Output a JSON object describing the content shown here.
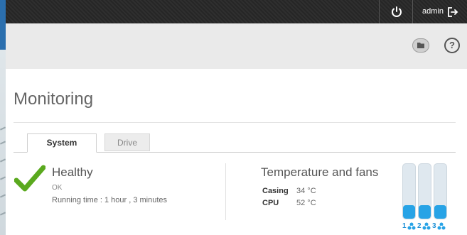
{
  "topbar": {
    "user": "admin"
  },
  "page": {
    "title": "Monitoring"
  },
  "tabs": [
    {
      "label": "System",
      "active": true
    },
    {
      "label": "Drive",
      "active": false
    }
  ],
  "health": {
    "title": "Healthy",
    "status": "OK",
    "running_time": "Running time : 1 hour , 3 minutes"
  },
  "temperature": {
    "title": "Temperature and fans",
    "rows": [
      {
        "label": "Casing",
        "value": "34 °C"
      },
      {
        "label": "CPU",
        "value": "52 °C"
      }
    ]
  },
  "fans": [
    {
      "label": "1",
      "level": 0.25
    },
    {
      "label": "2",
      "level": 0.25
    },
    {
      "label": "3",
      "level": 0.25
    }
  ],
  "colors": {
    "accent": "#27a3e6",
    "check": "#5aa91e",
    "topbar": "#2b2b2b"
  },
  "icons": {
    "power": "power-icon",
    "logout": "logout-icon",
    "folder": "folder-icon",
    "help": "help-icon",
    "check": "check-icon",
    "fan": "fan-icon"
  }
}
